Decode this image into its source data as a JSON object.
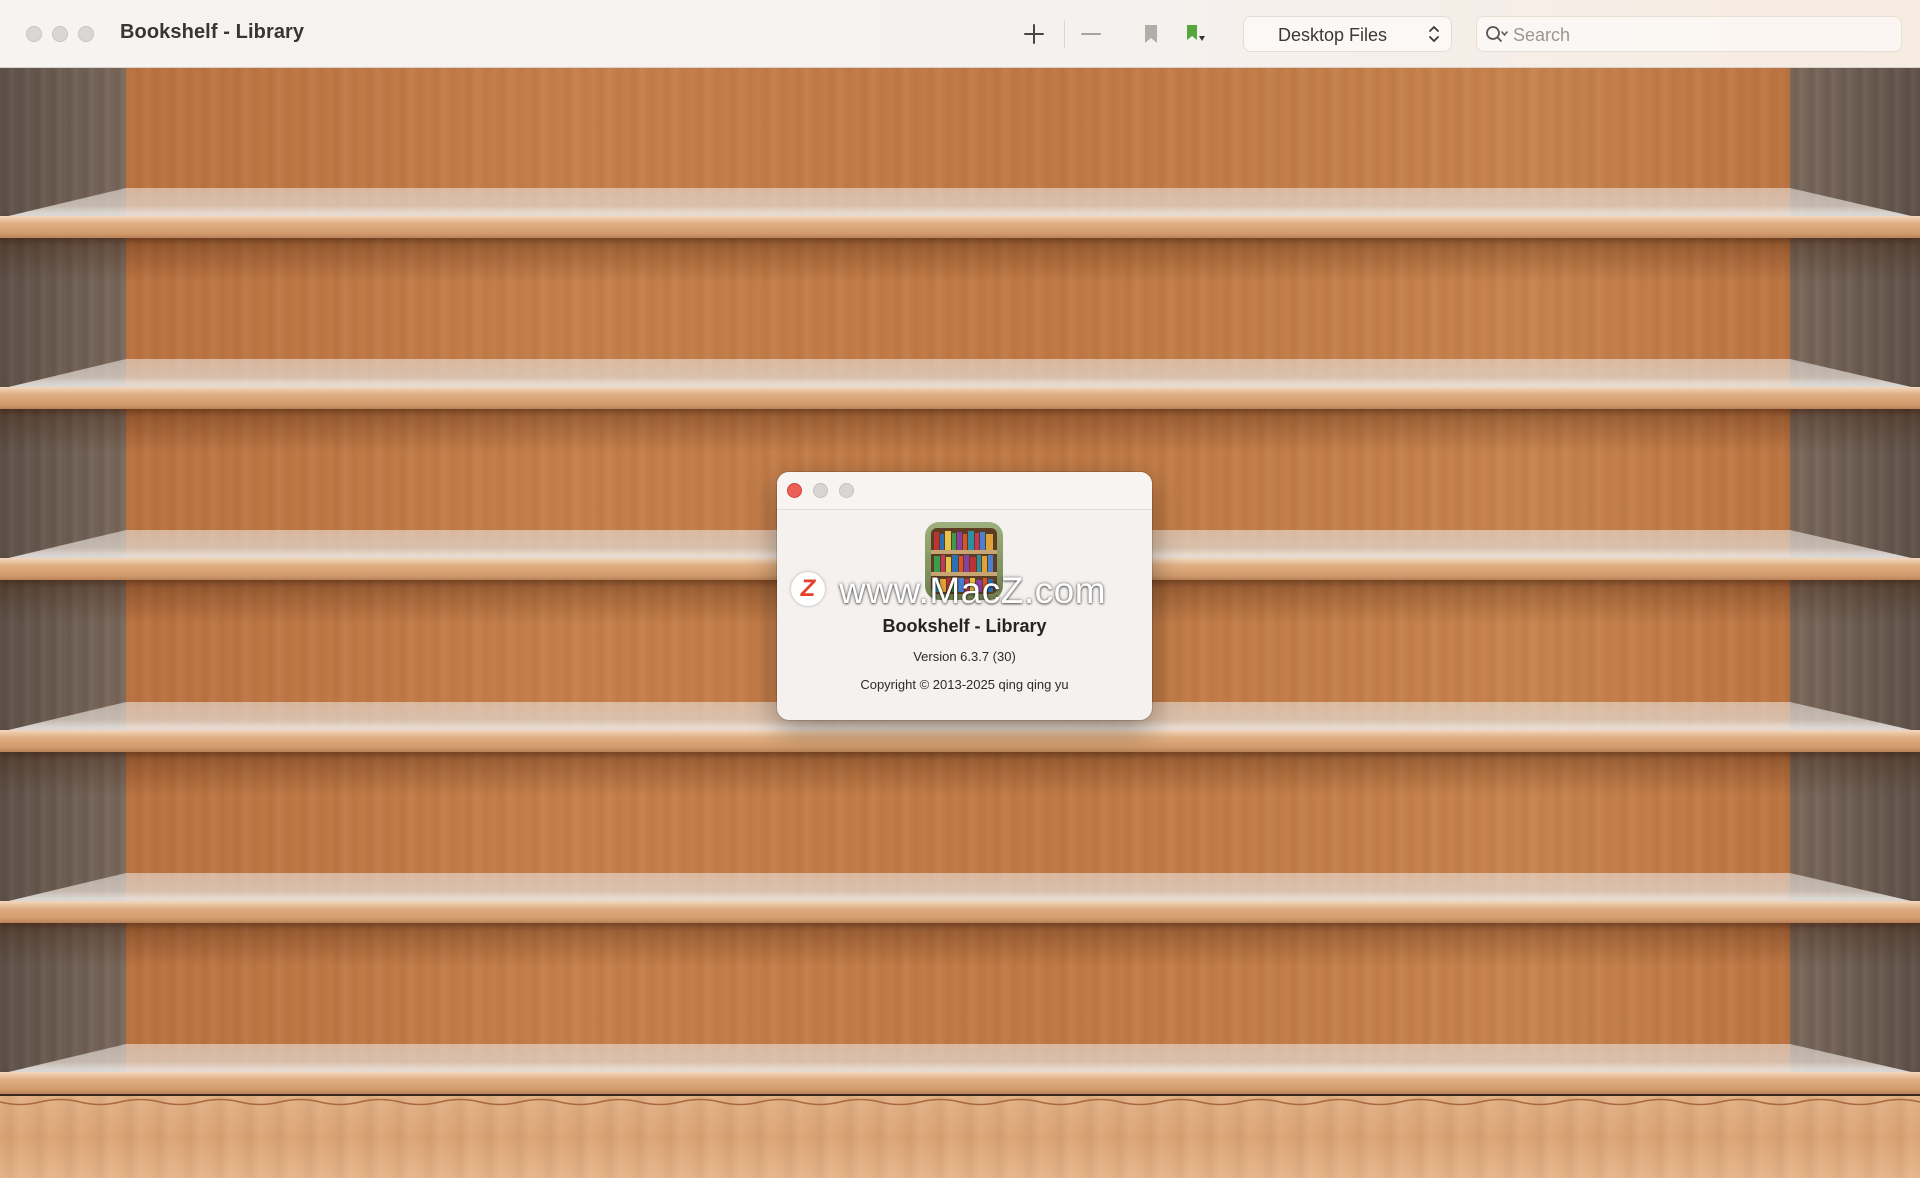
{
  "window": {
    "title": "Bookshelf - Library"
  },
  "toolbar": {
    "add_icon": "plus-icon",
    "remove_icon": "minus-icon",
    "bookmark_icon": "bookmark-icon",
    "tag_icon": "green-bookmark-dropdown-icon",
    "source_select": {
      "value": "Desktop Files"
    },
    "search": {
      "placeholder": "Search",
      "value": ""
    }
  },
  "about_dialog": {
    "app_name": "Bookshelf - Library",
    "version": "Version 6.3.7 (30)",
    "copyright": "Copyright © 2013-2025 qing qing yu",
    "watermark_badge": "Z",
    "watermark": "www.MacZ.com"
  },
  "colors": {
    "close_red": "#ec5f57",
    "wood": "#c27a45",
    "shelf_edge": "#dfae82"
  }
}
